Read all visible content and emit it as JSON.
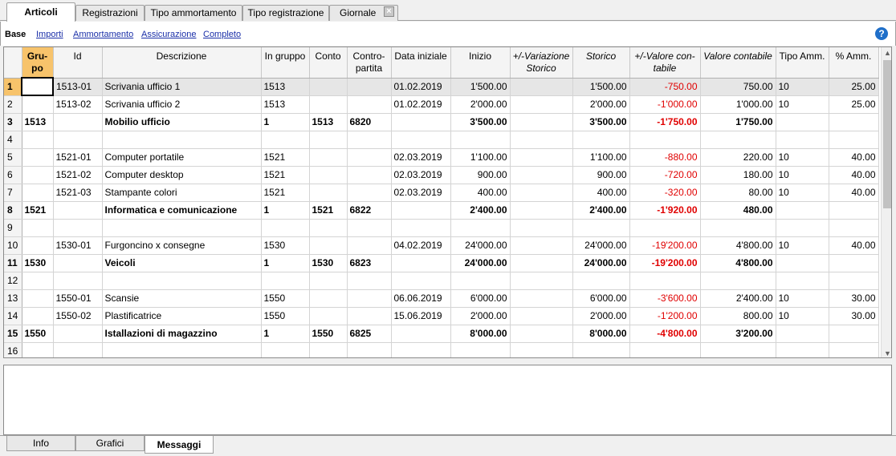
{
  "tabs": [
    "Articoli",
    "Registrazioni",
    "Tipo ammortamento",
    "Tipo registrazione",
    "Giornale"
  ],
  "close_icon": "close-icon",
  "views": [
    "Base",
    "Importi",
    "Ammortamento",
    "Assicurazione",
    "Completo"
  ],
  "help_icon": "?",
  "columns": [
    {
      "label": "Gru-\npo"
    },
    {
      "label": "Id"
    },
    {
      "label": "Descrizione"
    },
    {
      "label": "In gruppo"
    },
    {
      "label": "Conto"
    },
    {
      "label": "Contro-\npartita"
    },
    {
      "label": "Data iniziale"
    },
    {
      "label": "Inizio"
    },
    {
      "label": "+/-Variazione\nStorico"
    },
    {
      "label": "Storico"
    },
    {
      "label": "+/-Valore con-\ntabile"
    },
    {
      "label": "Valore contabile"
    },
    {
      "label": "Tipo Amm."
    },
    {
      "label": "% Amm."
    }
  ],
  "rows": [
    {
      "n": "1",
      "bold": false,
      "cells": [
        "",
        "1513-01",
        "Scrivania ufficio 1",
        "1513",
        "",
        "",
        "01.02.2019",
        "1'500.00",
        "",
        "1'500.00",
        "-750.00",
        "750.00",
        "10",
        "25.00"
      ]
    },
    {
      "n": "2",
      "bold": false,
      "cells": [
        "",
        "1513-02",
        "Scrivania ufficio 2",
        "1513",
        "",
        "",
        "01.02.2019",
        "2'000.00",
        "",
        "2'000.00",
        "-1'000.00",
        "1'000.00",
        "10",
        "25.00"
      ]
    },
    {
      "n": "3",
      "bold": true,
      "cells": [
        "1513",
        "",
        "Mobilio ufficio",
        "1",
        "1513",
        "6820",
        "",
        "3'500.00",
        "",
        "3'500.00",
        "-1'750.00",
        "1'750.00",
        "",
        ""
      ]
    },
    {
      "n": "4",
      "bold": false,
      "cells": [
        "",
        "",
        "",
        "",
        "",
        "",
        "",
        "",
        "",
        "",
        "",
        "",
        "",
        ""
      ]
    },
    {
      "n": "5",
      "bold": false,
      "cells": [
        "",
        "1521-01",
        "Computer portatile",
        "1521",
        "",
        "",
        "02.03.2019",
        "1'100.00",
        "",
        "1'100.00",
        "-880.00",
        "220.00",
        "10",
        "40.00"
      ]
    },
    {
      "n": "6",
      "bold": false,
      "cells": [
        "",
        "1521-02",
        "Computer desktop",
        "1521",
        "",
        "",
        "02.03.2019",
        "900.00",
        "",
        "900.00",
        "-720.00",
        "180.00",
        "10",
        "40.00"
      ]
    },
    {
      "n": "7",
      "bold": false,
      "cells": [
        "",
        "1521-03",
        "Stampante colori",
        "1521",
        "",
        "",
        "02.03.2019",
        "400.00",
        "",
        "400.00",
        "-320.00",
        "80.00",
        "10",
        "40.00"
      ]
    },
    {
      "n": "8",
      "bold": true,
      "cells": [
        "1521",
        "",
        "Informatica e comunicazione",
        "1",
        "1521",
        "6822",
        "",
        "2'400.00",
        "",
        "2'400.00",
        "-1'920.00",
        "480.00",
        "",
        ""
      ]
    },
    {
      "n": "9",
      "bold": false,
      "cells": [
        "",
        "",
        "",
        "",
        "",
        "",
        "",
        "",
        "",
        "",
        "",
        "",
        "",
        ""
      ]
    },
    {
      "n": "10",
      "bold": false,
      "cells": [
        "",
        "1530-01",
        "Furgoncino x consegne",
        "1530",
        "",
        "",
        "04.02.2019",
        "24'000.00",
        "",
        "24'000.00",
        "-19'200.00",
        "4'800.00",
        "10",
        "40.00"
      ]
    },
    {
      "n": "11",
      "bold": true,
      "cells": [
        "1530",
        "",
        "Veicoli",
        "1",
        "1530",
        "6823",
        "",
        "24'000.00",
        "",
        "24'000.00",
        "-19'200.00",
        "4'800.00",
        "",
        ""
      ]
    },
    {
      "n": "12",
      "bold": false,
      "cells": [
        "",
        "",
        "",
        "",
        "",
        "",
        "",
        "",
        "",
        "",
        "",
        "",
        "",
        ""
      ]
    },
    {
      "n": "13",
      "bold": false,
      "cells": [
        "",
        "1550-01",
        "Scansie",
        "1550",
        "",
        "",
        "06.06.2019",
        "6'000.00",
        "",
        "6'000.00",
        "-3'600.00",
        "2'400.00",
        "10",
        "30.00"
      ]
    },
    {
      "n": "14",
      "bold": false,
      "cells": [
        "",
        "1550-02",
        "Plastificatrice",
        "1550",
        "",
        "",
        "15.06.2019",
        "2'000.00",
        "",
        "2'000.00",
        "-1'200.00",
        "800.00",
        "10",
        "30.00"
      ]
    },
    {
      "n": "15",
      "bold": true,
      "cells": [
        "1550",
        "",
        "Istallazioni di magazzino",
        "1",
        "1550",
        "6825",
        "",
        "8'000.00",
        "",
        "8'000.00",
        "-4'800.00",
        "3'200.00",
        "",
        ""
      ]
    },
    {
      "n": "16",
      "bold": false,
      "cells": [
        "",
        "",
        "",
        "",
        "",
        "",
        "",
        "",
        "",
        "",
        "",
        "",
        "",
        ""
      ]
    }
  ],
  "bottom_tabs": [
    "Info",
    "Grafici",
    "Messaggi"
  ],
  "colors": {
    "selection": "#f7c36b",
    "negative": "#e00000",
    "link": "#1a2fa8"
  }
}
